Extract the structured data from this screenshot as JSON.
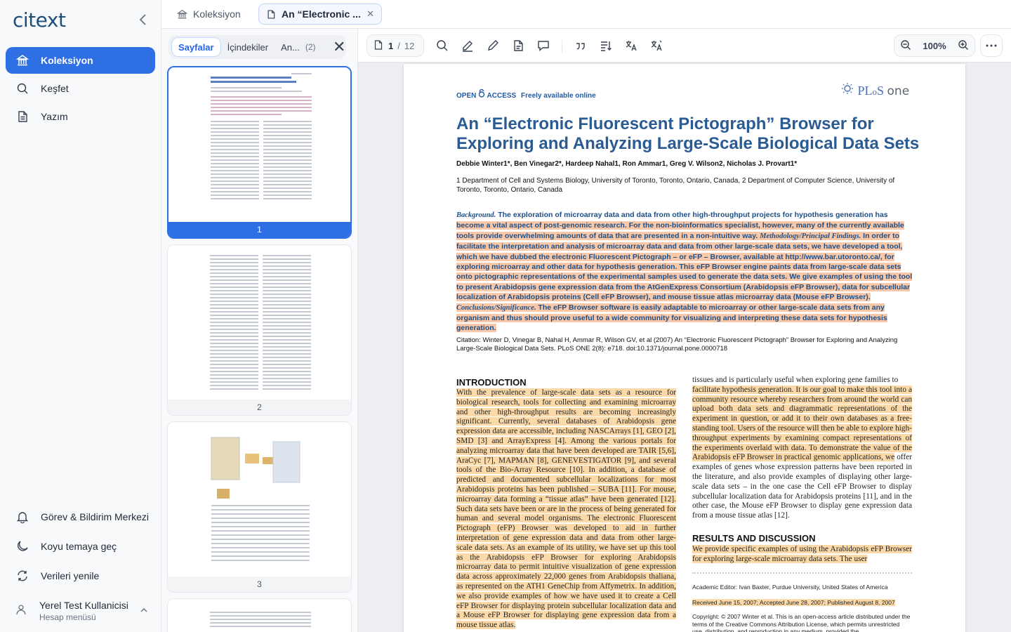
{
  "app": {
    "logo_ci": "ci",
    "logo_text": "text",
    "colors": {
      "accent": "#2f6fe4",
      "highlight_abstract": "#f9c8a8",
      "highlight_body": "#fbd9a8",
      "title_blue": "#2a5b93"
    }
  },
  "sidebar": {
    "collapse_icon": "chevron-left-icon",
    "items": [
      {
        "label": "Koleksiyon",
        "icon": "bank-icon",
        "active": true
      },
      {
        "label": "Keşfet",
        "icon": "search-icon",
        "active": false
      },
      {
        "label": "Yazım",
        "icon": "document-icon",
        "active": false
      }
    ],
    "bottom": [
      {
        "label": "Görev & Bildirim Merkezi",
        "icon": "bell-icon"
      },
      {
        "label": "Koyu temaya geç",
        "icon": "moon-icon"
      },
      {
        "label": "Verileri yenile",
        "icon": "refresh-icon"
      }
    ],
    "user": {
      "name": "Yerel Test Kullanicisi",
      "subtitle": "Hesap menüsü"
    }
  },
  "tabs": {
    "home_label": "Koleksiyon",
    "doc_label": "An “Electronic ...",
    "close": "✕"
  },
  "pages_panel": {
    "tabs": [
      {
        "label": "Sayfalar",
        "active": true
      },
      {
        "label": "İçindekiler",
        "active": false
      },
      {
        "label": "An...",
        "count": "(2)",
        "active": false
      }
    ],
    "close": "✕",
    "thumbs": [
      "1",
      "2",
      "3"
    ]
  },
  "toolbar": {
    "current_page": "1",
    "separator": "/",
    "total_pages": "12",
    "zoom": "100%",
    "tools": [
      "search-icon",
      "highlighter-icon",
      "pen-icon",
      "note-icon",
      "comment-icon",
      "quote-icon",
      "list-sort-icon",
      "translate-icon",
      "translate-alt-icon"
    ]
  },
  "document": {
    "open_access": "OPEN",
    "open_access_2": "ACCESS",
    "freely": "Freely available online",
    "journal": "PL",
    "journal_o": "o",
    "journal_s": "S",
    "journal_one": "one",
    "title": "An “Electronic Fluorescent Pictograph” Browser for Exploring and Analyzing Large-Scale Biological Data Sets",
    "authors": "Debbie Winter1*, Ben Vinegar2*, Hardeep Nahal1, Ron Ammar1, Greg V. Wilson2, Nicholas J. Provart1*",
    "affiliation": "1 Department of Cell and Systems Biology, University of Toronto, Toronto, Ontario, Canada, 2 Department of Computer Science, University of Toronto, Toronto, Ontario, Canada",
    "abstract": {
      "bg_label": "Background.",
      "bg_text_plain": " The exploration of microarray data and data from other high-throughput projects for hypothesis generation has",
      "bg_text_hl": "become a vital aspect of post-genomic research. For the non-bioinformatics specialist, however, many of the currently available tools provide overwhelming amounts of data that are presented in a non-intuitive way. ",
      "method_label": "Methodology/Principal Findings.",
      "method_text": " In order to facilitate the interpretation and analysis of microarray data and data from other large-scale data sets, we have developed a tool, which we have dubbed the electronic Fluorescent Pictograph – or eFP – Browser, available at http://www.bar.utoronto.ca/, for exploring microarray and other data for hypothesis generation. This eFP Browser engine paints data from large-scale data sets onto pictographic representations of the experimental samples used to generate the data sets. We give examples of using the tool to present Arabidopsis gene expression data from the AtGenExpress Consortium (Arabidopsis eFP Browser), data for subcellular localization of Arabidopsis proteins (Cell eFP Browser), and mouse tissue atlas microarray data (Mouse eFP Browser). ",
      "concl_label": "Conclusions/Significance.",
      "concl_text": " The eFP Browser software is easily adaptable to microarray or other large-scale data sets from any organism and thus should prove useful to a wide community for visualizing and interpreting these data sets for hypothesis generation."
    },
    "citation": "Citation:  Winter D, Vinegar B, Nahal H, Ammar R, Wilson GV, et al (2007) An “Electronic Fluorescent Pictograph” Browser for Exploring and Analyzing Large-Scale Biological Data Sets. PLoS ONE 2(8): e718. doi:10.1371/journal.pone.0000718",
    "intro_heading": "INTRODUCTION",
    "intro_text": "With the prevalence of large-scale data sets as a resource for biological research, tools for collecting and examining microarray and other high-throughput results are becoming increasingly significant. Currently, several databases of Arabidopsis gene expression data are accessible, including NASCArrays [1], GEO [2], SMD [3] and ArrayExpress [4]. Among the various portals for analyzing microarray data that have been developed are TAIR [5,6], AraCyc [7], MAPMAN [8], GENEVESTIGATOR [9], and several tools of the Bio-Array Resource [10]. In addition, a database of predicted and documented subcellular localizations for most Arabidopsis proteins has been published – SUBA [11]. For mouse, microarray data forming a “tissue atlas” have been generated [12]. Such data sets have been or are in the process of being generated for human and several model organisms. The electronic Fluorescent Pictograph (eFP) Browser was developed to aid in further interpretation of gene expression data and data from other large-scale data sets. As an example of its utility, we have set up this tool as the Arabidopsis eFP Browser for exploring Arabidopsis microarray data to permit intuitive visualization of gene expression data across approximately 22,000 genes from Arabidopsis thaliana, as represented on the ATH1 GeneChip from Affymetrix. In addition, we also provide examples of how we have used it to create a Cell eFP Browser for displaying protein subcellular localization data and a Mouse eFP Browser for displaying gene expression data from a mouse tissue atlas.",
    "right_top_plain": "tissues and is particularly useful when exploring gene families to",
    "right_text_hl": "facilitate hypothesis generation. It is our goal to make this tool into a community resource whereby researchers from around the world can upload both data sets and diagrammatic representations of the experiment in question, or add it to their own databases as a free-standing tool. Users of the resource will then be able to explore high-throughput experiments by examining compact representations of the experiments overlaid with data. To demonstrate the value of the Arabidopsis eFP Browser in practical genomic applications, we",
    "right_text_plain": "offer examples of genes whose expression patterns have been reported in the literature, and also provide examples of displaying other large-scale data sets – in the one case the Cell eFP Browser to display subcellular localization data for Arabidopsis proteins [11], and in the other case, the Mouse eFP Browser to display gene expression data from a mouse tissue atlas [12].",
    "results_heading": "RESULTS AND DISCUSSION",
    "results_text": "We provide specific examples of using the Arabidopsis eFP Browser for exploring large-scale microarray data sets. The user",
    "editor": "Academic Editor: Ivan Baxter, Purdue University, United States of America",
    "received": "Received June 15, 2007; Accepted June 28, 2007; Published August 8, 2007",
    "copyright": "Copyright: © 2007 Winter et al. This is an open-access article distributed under the terms of the Creative Commons Attribution License, which permits unrestricted use, distribution, and reproduction in any medium, provided the"
  }
}
